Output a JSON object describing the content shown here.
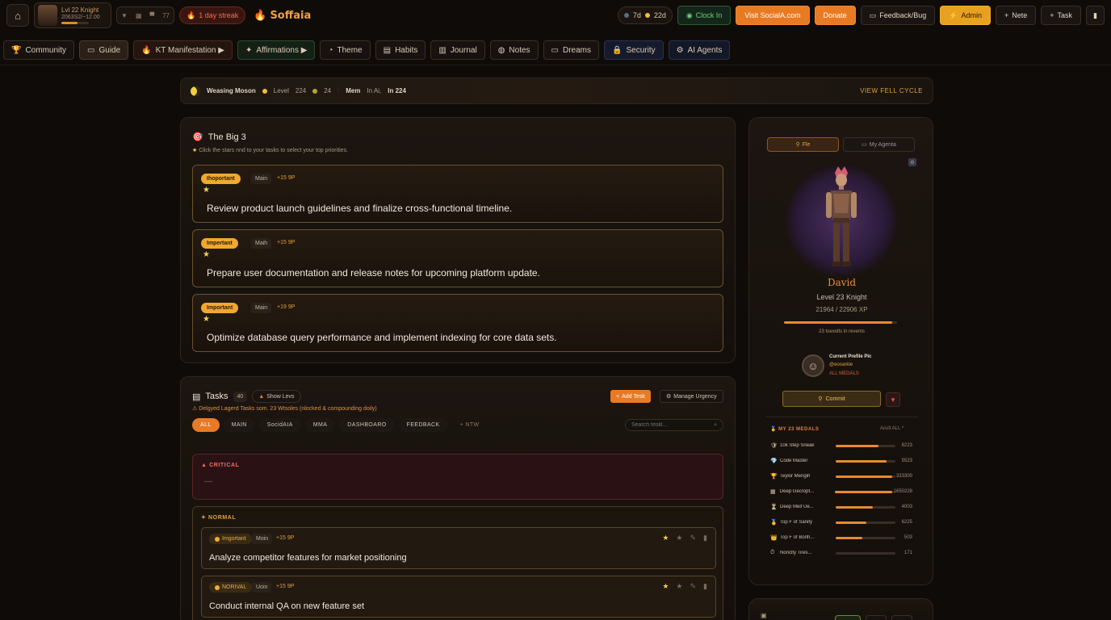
{
  "topbar": {
    "home_icon": "home-icon",
    "player": {
      "level_text": "Lvl 22 Knight",
      "xp_text": "2063S2/~12.00",
      "xp_progress": 0.6
    },
    "mini_stats": [
      "▼",
      "▦",
      "▀",
      "77"
    ],
    "streak": "1 day streak",
    "brand": "Soffaia",
    "pill_week": "7d",
    "pill_coins": "22d",
    "clock_in": "Clock In",
    "visit": "Visit SocialA.com",
    "donate": "Donate",
    "feedback": "Feedback/Bug",
    "admin": "Admin",
    "note": "Nete",
    "task": "Task"
  },
  "nav": [
    "Community",
    "Guide",
    "KT Manifestation ▶",
    "Affirmations ▶",
    "Theme",
    "Habits",
    "Journal",
    "Notes",
    "Dreams",
    "Security",
    "AI Agents"
  ],
  "cycle": {
    "phase": "Weasing Moson",
    "level_label": "Level",
    "v1": "224",
    "v2": "24",
    "mem_label": "Mem",
    "in_label": "In Ai,",
    "v3": "In 224",
    "link": "VIEW FELL CYCLE"
  },
  "big3": {
    "title": "The Big 3",
    "subtitle": "Click the stars nnd to your tasks to select your top priorities.",
    "cards": [
      {
        "badge": "Ihoportant",
        "category": "Main",
        "xp": "+15 9P",
        "text": "Review product launch guidelines and finalize cross-functional timeline."
      },
      {
        "badge": "Impertant",
        "category": "Maih",
        "xp": "+15 9P",
        "text": "Prepare user documentation and release notes for upcoming platform update."
      },
      {
        "badge": "Important",
        "category": "Main",
        "xp": "+19 9P",
        "text": "Optimize database query performance and implement indexing for core data sets."
      }
    ]
  },
  "tasks": {
    "title": "Tasks",
    "count": "40",
    "show_levels": "Show Levs",
    "warning": "Delgyed Lagerd Tasks som. 23 Wtsoles (nlocked & compounding doily)",
    "add_task": "Add Tesk",
    "manage_urgency": "Manage Urgency",
    "tabs": [
      "ALL",
      "MAIN",
      "SocidAIA",
      "MMA",
      "DASHBOARO",
      "FEEDBACK",
      "+ NTW"
    ],
    "search_placeholder": "Search teskl...",
    "critical": {
      "label": "CRITICAL",
      "empty": "—"
    },
    "normal": {
      "label": "NORMAL",
      "items": [
        {
          "badge": "Imgortant",
          "category": "Moin",
          "xp": "+15 9P",
          "text": "Analyze competitor features for market positioning"
        },
        {
          "badge": "NORIVAL",
          "category": "Uoin",
          "xp": "+15 9P",
          "text": "Conduct internal QA on new feature set"
        }
      ]
    }
  },
  "profile": {
    "tab_profile": "Fle",
    "tab_agents": "My Agenta",
    "name": "David",
    "level": "Level 23 Knight",
    "xp": "21964 / 22906 XP",
    "xp_progress": 0.96,
    "to_next": "23 toexolts in revems",
    "pic_title": "Current Prefile Pic",
    "pic_handle": "@eooarkle",
    "pic_link": "ALL MEDALS",
    "commit": "Commit",
    "medals_title": "MY 23 MEDALS",
    "medals_collapse": "Acult ALL",
    "medals": [
      {
        "icon": "🛡",
        "name": "10k Step Sneak",
        "value": "8223",
        "progress": 0.72
      },
      {
        "icon": "💎",
        "name": "Code Master",
        "value": "5523",
        "progress": 0.85
      },
      {
        "icon": "🏆",
        "name": "Teylor Mengih",
        "value": "333300",
        "progress": 0.95
      },
      {
        "icon": "▦",
        "name": "Deep Gecropt...",
        "value": "1650228",
        "progress": 0.98
      },
      {
        "icon": "⏳",
        "name": "Deep Meif Ue...",
        "value": "4003",
        "progress": 0.62
      },
      {
        "icon": "🥇",
        "name": "Top F of Sanity",
        "value": "6225",
        "progress": 0.52
      },
      {
        "icon": "👑",
        "name": "Top F of Borlh...",
        "value": "503",
        "progress": 0.44
      },
      {
        "icon": "⏱",
        "name": "Nonclty Tires...",
        "value": "171",
        "progress": 0.0
      }
    ]
  },
  "colors": {
    "accent": "#e87a24",
    "gold": "#e8a020",
    "bg": "#0f0b08",
    "critical": "#f07060"
  }
}
